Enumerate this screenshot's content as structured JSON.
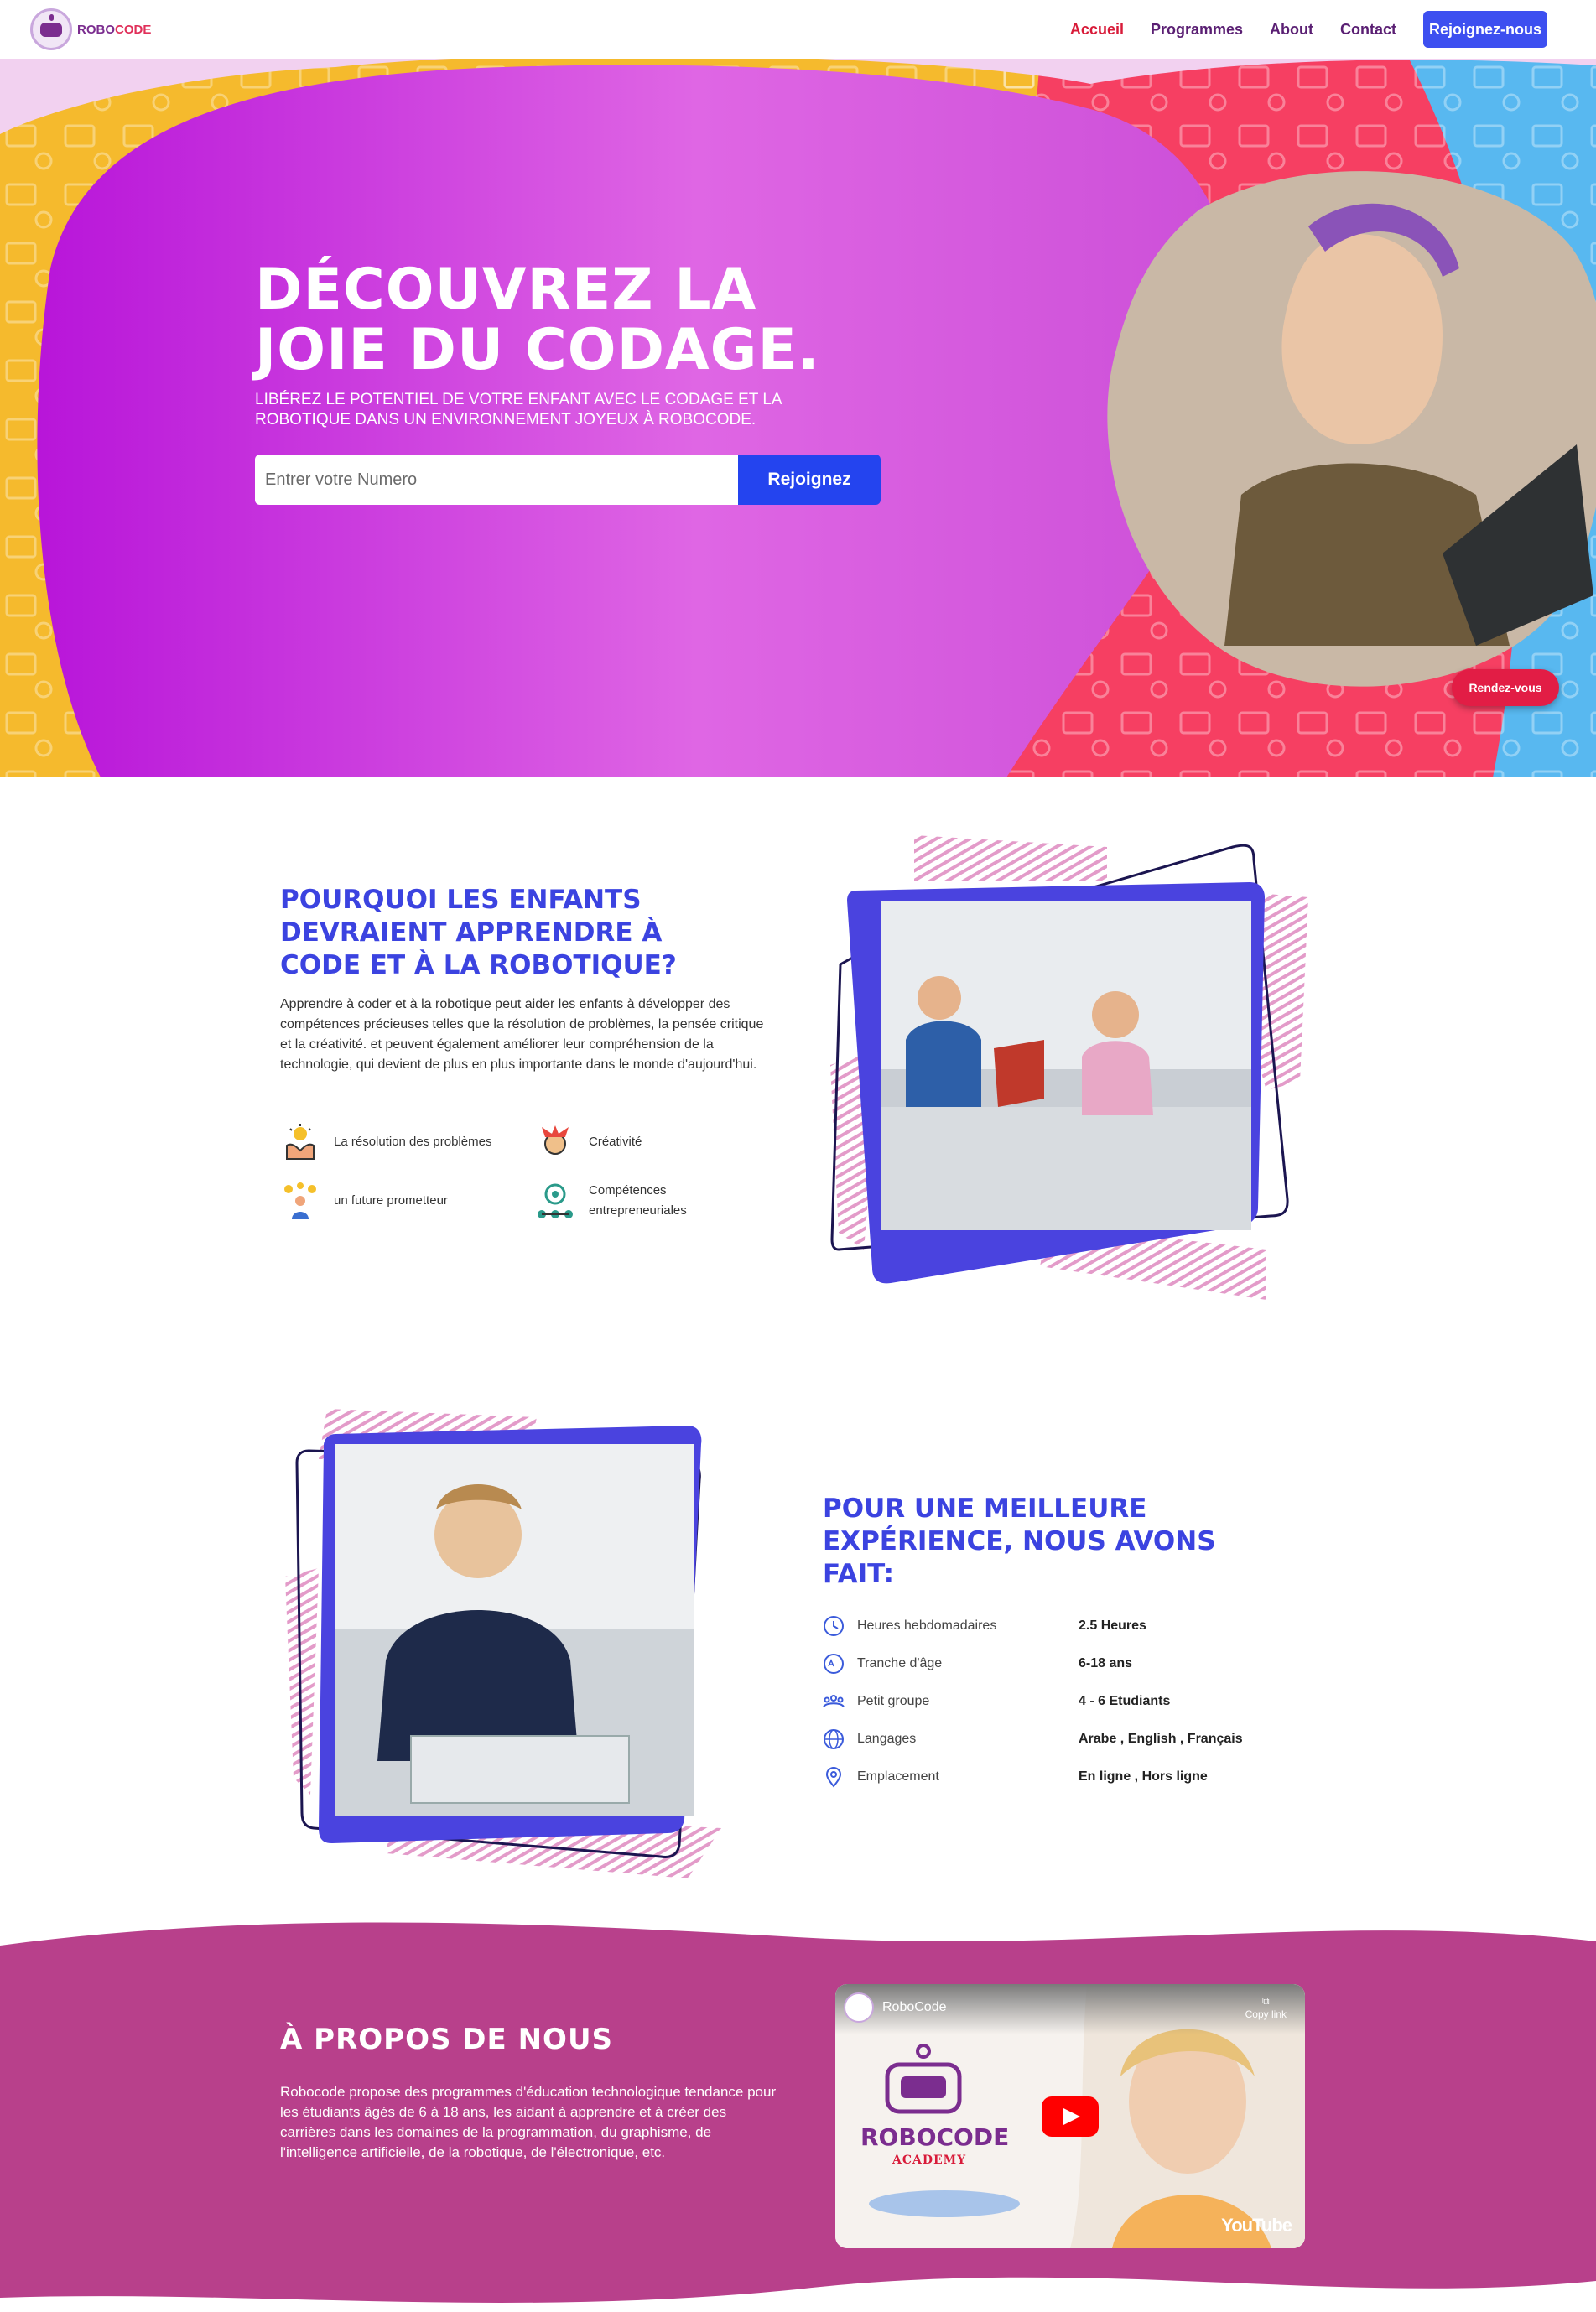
{
  "header": {
    "logo_text_1": "ROBO",
    "logo_text_2": "CODE",
    "nav": [
      "Accueil",
      "Programmes",
      "About",
      "Contact"
    ],
    "cta": "Rejoignez-nous"
  },
  "hero": {
    "title": "DÉCOUVREZ LA JOIE DU CODAGE.",
    "subtitle": "LIBÉREZ LE POTENTIEL DE VOTRE ENFANT AVEC LE CODAGE ET LA ROBOTIQUE DANS UN ENVIRONNEMENT JOYEUX À ROBOCODE.",
    "input_placeholder": "Entrer votre Numero",
    "button": "Rejoignez",
    "appointment_button": "Rendez-vous"
  },
  "why": {
    "title": "POURQUOI LES ENFANTS DEVRAIENT APPRENDRE À CODE ET À LA ROBOTIQUE?",
    "text": "Apprendre à coder et à la robotique peut aider les enfants à développer des compétences précieuses telles que la résolution de problèmes, la pensée critique et la créativité. et peuvent également améliorer leur compréhension de la technologie, qui devient de plus en plus importante dans le monde d'aujourd'hui.",
    "features": [
      {
        "label": "La résolution des problèmes",
        "icon": "problem-solving-icon"
      },
      {
        "label": "Créativité",
        "icon": "creativity-icon"
      },
      {
        "label": "un future prometteur",
        "icon": "future-icon"
      },
      {
        "label": "Compétences entrepreneuriales",
        "icon": "entrepreneur-icon"
      }
    ]
  },
  "experience": {
    "title": "POUR UNE MEILLEURE EXPÉRIENCE, NOUS AVONS FAIT:",
    "rows": [
      {
        "label": "Heures hebdomadaires",
        "value": "2.5 Heures",
        "icon": "clock-icon"
      },
      {
        "label": "Tranche d'âge",
        "value": "6-18 ans",
        "icon": "age-icon"
      },
      {
        "label": "Petit groupe",
        "value": "4 - 6 Etudiants",
        "icon": "group-icon"
      },
      {
        "label": "Langages",
        "value": "Arabe , English , Français",
        "icon": "globe-icon"
      },
      {
        "label": "Emplacement",
        "value": "En ligne , Hors ligne",
        "icon": "location-icon"
      }
    ]
  },
  "about": {
    "title": "À PROPOS DE NOUS",
    "text": "Robocode propose des programmes d'éducation technologique tendance pour les étudiants âgés de 6 à 18 ans, les aidant à apprendre et à créer des carrières dans les domaines de la programmation, du graphisme, de l'intelligence artificielle, de la robotique, de l'électronique, etc.",
    "video": {
      "channel": "RoboCode",
      "copy_link": "Copy link",
      "brand": "ROBOCODE",
      "academy": "ACADEMY",
      "youtube": "YouTube"
    }
  },
  "colors": {
    "primary_blue": "#2444ef",
    "accent_red": "#d81b39",
    "purple": "#c01fd4",
    "about_bg": "#b8408b"
  }
}
